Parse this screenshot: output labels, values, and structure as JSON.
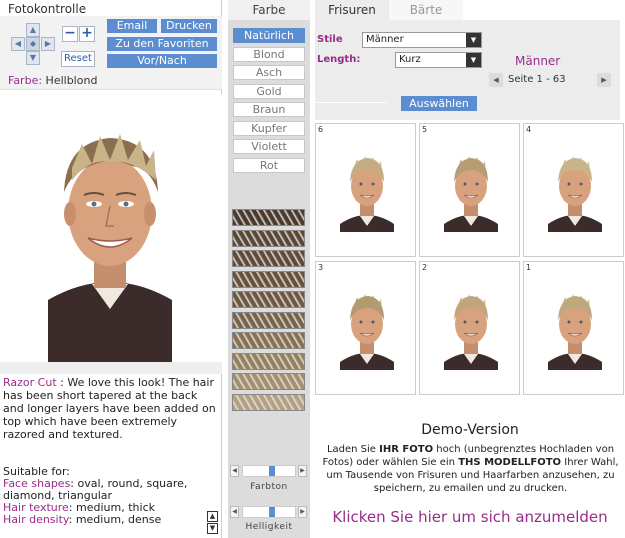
{
  "left": {
    "title": "Fotokontrolle",
    "buttons": {
      "email": "Email",
      "print": "Drucken",
      "favorites": "Zu den Favoriten",
      "prevnext": "Vor/Nach",
      "reset": "Reset",
      "zoom_out": "−",
      "zoom_in": "+"
    },
    "farbe_label": "Farbe:",
    "farbe_value": "Hellblond",
    "desc_name": "Razor Cut",
    "desc_text": " : We love this look! The hair has been short tapered at the back and longer layers have been added on top which have been extremely razored and textured.",
    "suitable_title": "Suitable for:",
    "face_label": "Face shapes",
    "face_value": ": oval, round, square, diamond, triangular",
    "texture_label": "Hair texture",
    "texture_value": ": medium, thick",
    "density_label": "Hair density",
    "density_value": ": medium, dense"
  },
  "colors": {
    "header": "Farbe",
    "items": [
      "Natürlich",
      "Blond",
      "Asch",
      "Gold",
      "Braun",
      "Kupfer",
      "Violett",
      "Rot"
    ],
    "selected_index": 0,
    "swatches": [
      "#4a3a2c",
      "#5a4634",
      "#5e4a36",
      "#67513b",
      "#6e5740",
      "#796248",
      "#86704f",
      "#95805e",
      "#a38f6e",
      "#b2a080"
    ],
    "slider_farbton_label": "Farbton",
    "slider_helligkeit_label": "Helligkeit",
    "slider_farbton_value": 0.55,
    "slider_helligkeit_value": 0.55
  },
  "right": {
    "tabs": [
      "Frisuren",
      "Bärte"
    ],
    "active_tab": 0,
    "stile_label": "Stile",
    "stile_value": "Männer",
    "length_label": "Length:",
    "length_value": "Kurz",
    "gender": "Männer",
    "page_info": "Seite 1 - 63",
    "select_button": "Auswählen",
    "thumbs": [
      "6",
      "5",
      "4",
      "3",
      "2",
      "1"
    ],
    "demo_title": "Demo-Version",
    "demo_text_1": "Laden Sie ",
    "demo_text_bold1": "IHR FOTO",
    "demo_text_2": " hoch (unbegrenztes Hochladen von Fotos) oder wählen Sie ein ",
    "demo_text_bold2": "THS MODELLFOTO",
    "demo_text_3": " Ihrer Wahl, um Tausende von Frisuren und Haarfarben anzusehen, zu speichern, zu emailen und zu drucken.",
    "signup": "Klicken Sie hier um sich anzumelden"
  }
}
